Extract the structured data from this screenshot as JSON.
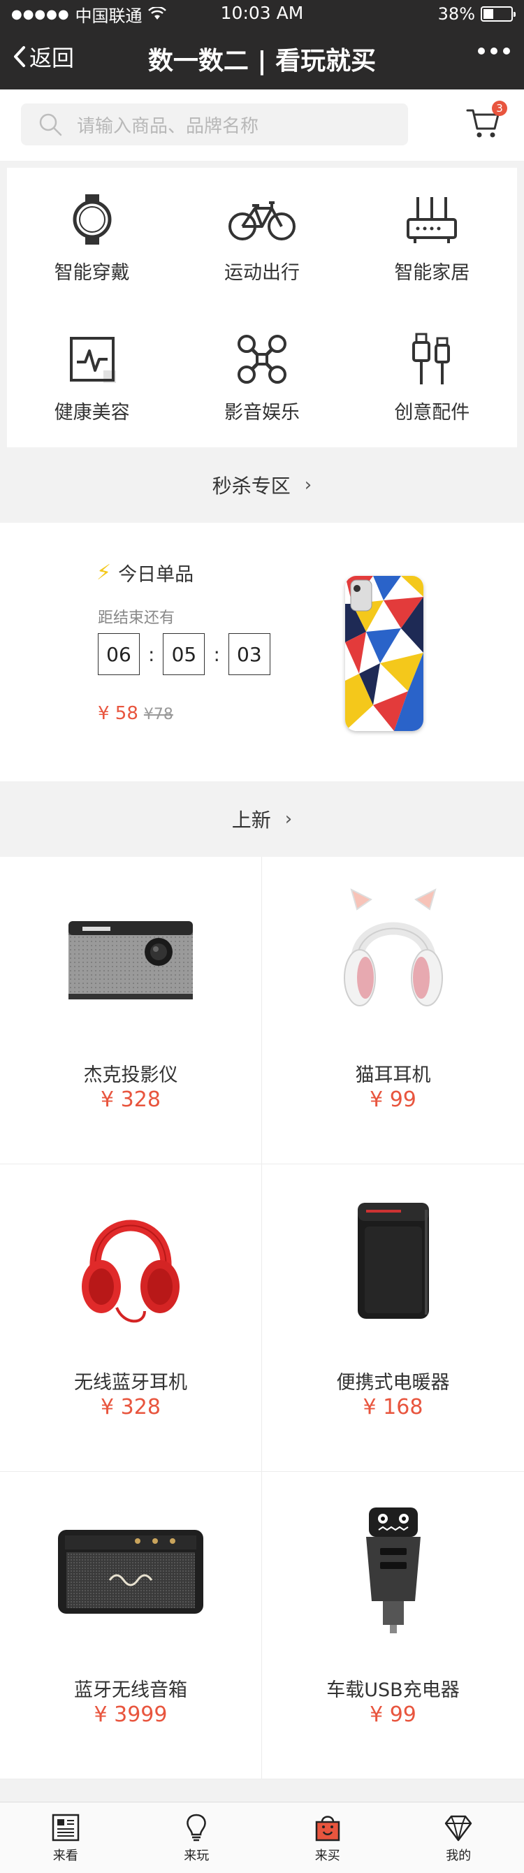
{
  "status_bar": {
    "signal": "●●●●●",
    "carrier": "中国联通",
    "time": "10:03 AM",
    "battery": "38%",
    "battery_level": 0.38
  },
  "nav": {
    "back_label": "返回",
    "title": "数一数二 | 看玩就买"
  },
  "search": {
    "placeholder": "请输入商品、品牌名称",
    "cart_count": "3"
  },
  "categories": [
    {
      "label": "智能穿戴",
      "icon": "smartwatch-icon"
    },
    {
      "label": "运动出行",
      "icon": "bicycle-icon"
    },
    {
      "label": "智能家居",
      "icon": "router-icon"
    },
    {
      "label": "健康美容",
      "icon": "health-monitor-icon"
    },
    {
      "label": "影音娱乐",
      "icon": "drone-icon"
    },
    {
      "label": "创意配件",
      "icon": "usb-cable-icon"
    }
  ],
  "flash_section": {
    "header": "秒杀专区",
    "chevron": "›"
  },
  "flash_item": {
    "title": "今日单品",
    "countdown_label": "距结束还有",
    "hours": "06",
    "minutes": "05",
    "seconds": "03",
    "separator": ":",
    "price_now": "¥ 58",
    "price_old": "¥78"
  },
  "new_section": {
    "header": "上新",
    "chevron": "›"
  },
  "products": [
    {
      "name": "杰克投影仪",
      "price": "¥ 328",
      "icon": "projector-image"
    },
    {
      "name": "猫耳耳机",
      "price": "¥ 99",
      "icon": "cat-ear-headphones-image"
    },
    {
      "name": "无线蓝牙耳机",
      "price": "¥ 328",
      "icon": "red-headphones-image"
    },
    {
      "name": "便携式电暖器",
      "price": "¥ 168",
      "icon": "heater-image"
    },
    {
      "name": "蓝牙无线音箱",
      "price": "¥ 3999",
      "icon": "speaker-image"
    },
    {
      "name": "车载USB充电器",
      "price": "¥ 99",
      "icon": "car-charger-image"
    }
  ],
  "tabs": [
    {
      "label": "来看",
      "icon": "news-icon"
    },
    {
      "label": "来玩",
      "icon": "lightbulb-icon"
    },
    {
      "label": "来买",
      "icon": "shopping-bag-icon"
    },
    {
      "label": "我的",
      "icon": "diamond-icon"
    }
  ],
  "colors": {
    "nav_bg": "#2b2a2a",
    "accent": "#e8553e",
    "bolt": "#f4c81b",
    "page_bg": "#f2f2f2"
  }
}
